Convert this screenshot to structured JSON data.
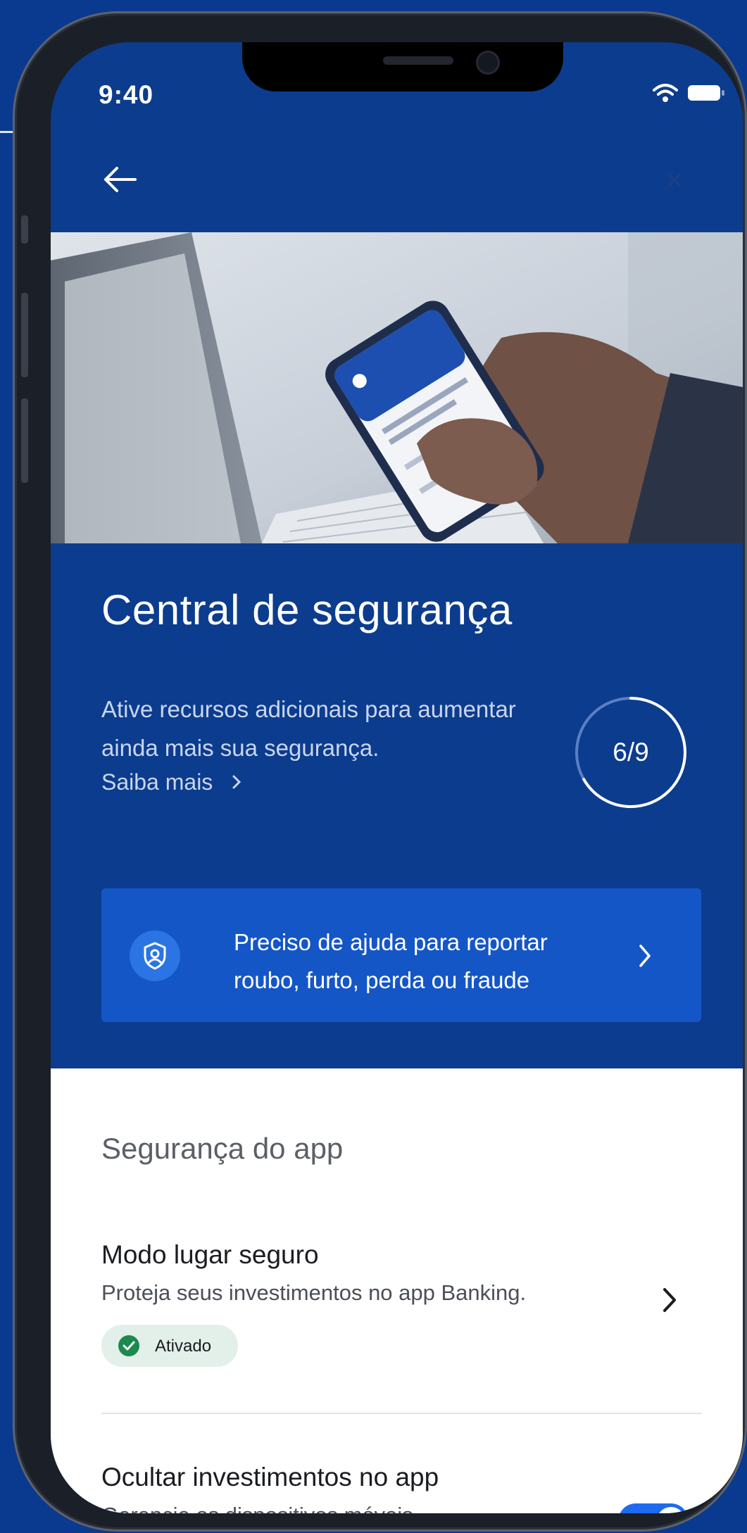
{
  "status_bar": {
    "time": "9:40"
  },
  "nav": {
    "back_icon": "arrow-left-icon",
    "close_icon": "close-icon"
  },
  "hero": {
    "image": "person holding phone in front of laptop"
  },
  "header": {
    "title": "Central de segurança",
    "subtitle": "Ative recursos adicionais para aumentar ainda mais sua segurança.",
    "link_label": "Saiba mais",
    "progress_label": "6/9",
    "progress_fraction": 0.667
  },
  "help_card": {
    "icon": "shield-person-icon",
    "text_line1": "Preciso de ajuda para reportar",
    "text_line2": "roubo, furto, perda ou fraude"
  },
  "app_security": {
    "section_title": "Segurança do app",
    "items": [
      {
        "title": "Modo lugar seguro",
        "description": "Proteja seus investimentos no app Banking.",
        "badge": "Ativado"
      },
      {
        "title": "Ocultar investimentos no app",
        "description": "Gerencie os dispositivos móveis",
        "toggle_on": true
      }
    ]
  },
  "colors": {
    "background": "#0a3a8f",
    "screen": "#0c3c8e",
    "card": "#1556c7",
    "accent": "#1f6bf0",
    "success": "#1b8a4f"
  }
}
